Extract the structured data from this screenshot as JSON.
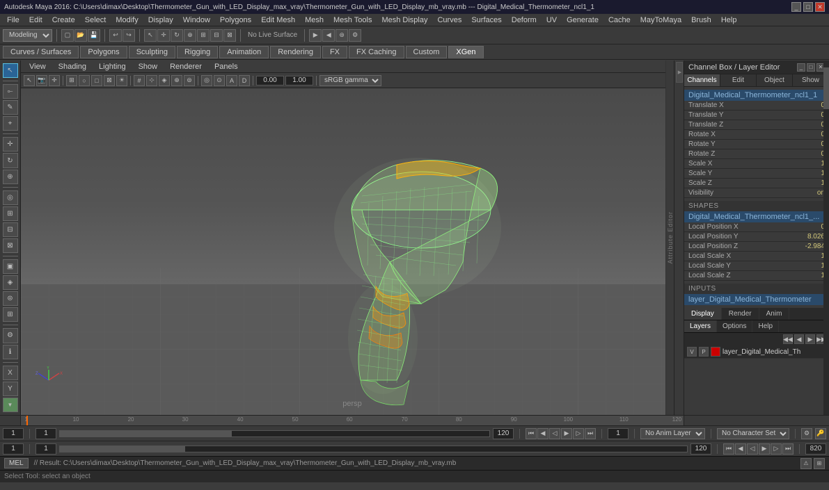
{
  "titlebar": {
    "title": "Autodesk Maya 2016: C:\\Users\\dimax\\Desktop\\Thermometer_Gun_with_LED_Display_max_vray\\Thermometer_Gun_with_LED_Display_mb_vray.mb  ---  Digital_Medical_Thermometer_ncl1_1"
  },
  "menubar": {
    "items": [
      "File",
      "Edit",
      "Create",
      "Select",
      "Modify",
      "Display",
      "Window",
      "Polygons",
      "Edit Mesh",
      "Mesh",
      "Mesh Tools",
      "Mesh Display",
      "Curves",
      "Surfaces",
      "Deform",
      "UV",
      "Generate",
      "Cache",
      "MayToMaya",
      "Brush",
      "Help"
    ]
  },
  "toolbar": {
    "workspace_label": "Modeling",
    "no_live_surface": "No Live Surface"
  },
  "module_tabs": {
    "items": [
      {
        "label": "Curves / Surfaces",
        "active": false
      },
      {
        "label": "Polygons",
        "active": false
      },
      {
        "label": "Sculpting",
        "active": false
      },
      {
        "label": "Rigging",
        "active": false
      },
      {
        "label": "Animation",
        "active": false
      },
      {
        "label": "Rendering",
        "active": false
      },
      {
        "label": "FX",
        "active": false
      },
      {
        "label": "FX Caching",
        "active": false
      },
      {
        "label": "Custom",
        "active": false
      },
      {
        "label": "XGen",
        "active": true
      }
    ]
  },
  "viewport": {
    "menu_items": [
      "View",
      "Shading",
      "Lighting",
      "Show",
      "Renderer",
      "Panels"
    ],
    "gamma": "sRGB gamma",
    "coord_x": "0.00",
    "coord_y": "1.00",
    "persp_label": "persp"
  },
  "channel_box": {
    "title": "Channel Box / Layer Editor",
    "tabs": {
      "channels": "Channels",
      "edit": "Edit",
      "object": "Object",
      "show": "Show"
    },
    "node_name": "Digital_Medical_Thermometer_ncl1_1",
    "transforms": [
      {
        "label": "Translate X",
        "value": "0"
      },
      {
        "label": "Translate Y",
        "value": "0"
      },
      {
        "label": "Translate Z",
        "value": "0"
      },
      {
        "label": "Rotate X",
        "value": "0"
      },
      {
        "label": "Rotate Y",
        "value": "0"
      },
      {
        "label": "Rotate Z",
        "value": "0"
      },
      {
        "label": "Scale X",
        "value": "1"
      },
      {
        "label": "Scale Y",
        "value": "1"
      },
      {
        "label": "Scale Z",
        "value": "1"
      },
      {
        "label": "Visibility",
        "value": "on"
      }
    ],
    "shapes_title": "SHAPES",
    "shapes_node": "Digital_Medical_Thermometer_ncl1_...",
    "shapes_props": [
      {
        "label": "Local Position X",
        "value": "0"
      },
      {
        "label": "Local Position Y",
        "value": "8.026"
      },
      {
        "label": "Local Position Z",
        "value": "-2.984"
      },
      {
        "label": "Local Scale X",
        "value": "1"
      },
      {
        "label": "Local Scale Y",
        "value": "1"
      },
      {
        "label": "Local Scale Z",
        "value": "1"
      }
    ],
    "inputs_title": "INPUTS",
    "inputs_node": "layer_Digital_Medical_Thermometer"
  },
  "display_tabs": {
    "items": [
      "Display",
      "Render",
      "Anim"
    ],
    "active": "Display"
  },
  "layer_tabs": {
    "items": [
      "Layers",
      "Options",
      "Help"
    ],
    "active": "Layers"
  },
  "layers": [
    {
      "v": "V",
      "p": "P",
      "color": "#cc0000",
      "name": "layer_Digital_Medical_Th"
    }
  ],
  "timeline": {
    "start": "1",
    "end": "120",
    "current": "1",
    "range_start": "1",
    "range_end": "120",
    "ticks": [
      "1",
      "10",
      "20",
      "30",
      "40",
      "50",
      "60",
      "70",
      "80",
      "90",
      "100",
      "110",
      "120"
    ]
  },
  "lower_controls": {
    "field1": "1",
    "field2": "1",
    "field3": "1",
    "field4": "120",
    "range_start": "1",
    "range_end": "120",
    "field5": "1",
    "no_anim_label": "No Anim Layer",
    "no_char_label": "No Character Set"
  },
  "lower_controls_2": {
    "field1": "1",
    "field2": "1",
    "field3": "1",
    "field4": "120"
  },
  "status_bar": {
    "mode": "MEL",
    "result_text": "// Result: C:\\Users\\dimax\\Desktop\\Thermometer_Gun_with_LED_Display_max_vray\\Thermometer_Gun_with_LED_Display_mb_vray.mb"
  },
  "help_bar": {
    "text": "Select Tool: select an object"
  },
  "attr_editor_label": "Attribute Editor"
}
